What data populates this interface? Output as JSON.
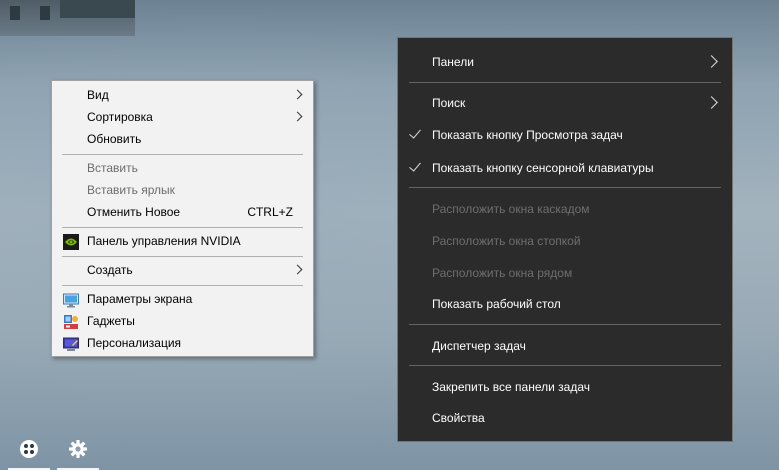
{
  "desktop_menu": {
    "items": [
      {
        "label": "Вид"
      },
      {
        "label": "Сортировка"
      },
      {
        "label": "Обновить"
      },
      {
        "label": "Вставить"
      },
      {
        "label": "Вставить ярлык"
      },
      {
        "label": "Отменить Новое",
        "shortcut": "CTRL+Z"
      },
      {
        "label": "Панель управления NVIDIA",
        "icon": "nvidia-icon"
      },
      {
        "label": "Создать"
      },
      {
        "label": "Параметры экрана",
        "icon": "display-icon"
      },
      {
        "label": "Гаджеты",
        "icon": "gadgets-icon"
      },
      {
        "label": "Персонализация",
        "icon": "personalization-icon"
      }
    ]
  },
  "taskbar_menu": {
    "items": [
      {
        "label": "Панели"
      },
      {
        "label": "Поиск"
      },
      {
        "label": "Показать кнопку Просмотра задач",
        "checked": true
      },
      {
        "label": "Показать кнопку сенсорной клавиатуры",
        "checked": true
      },
      {
        "label": "Расположить окна каскадом"
      },
      {
        "label": "Расположить окна стопкой"
      },
      {
        "label": "Расположить окна рядом"
      },
      {
        "label": "Показать рабочий стол"
      },
      {
        "label": "Диспетчер задач"
      },
      {
        "label": "Закрепить все панели задач"
      },
      {
        "label": "Свойства"
      }
    ]
  },
  "taskbar": {
    "buttons": [
      {
        "icon": "app-hub-icon"
      },
      {
        "icon": "gear-icon"
      }
    ]
  },
  "colors": {
    "dark_menu_bg": "#2b2b2b",
    "light_menu_bg": "#f2f2f2",
    "nvidia_green": "#76b900"
  }
}
